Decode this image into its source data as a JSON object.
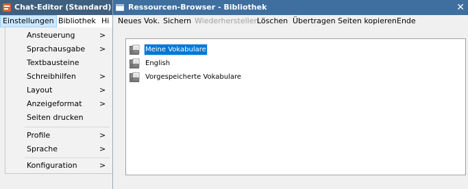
{
  "left_window": {
    "title": "Chat-Editor (Standard)",
    "menubar": [
      {
        "label": "Einstellungen"
      },
      {
        "label": "Bibliothek"
      },
      {
        "label": "Hi"
      }
    ],
    "dropdown": {
      "items": [
        {
          "label": "Ansteuerung",
          "submenu": true
        },
        {
          "label": "Sprachausgabe",
          "submenu": true
        },
        {
          "label": "Textbausteine",
          "submenu": false
        },
        {
          "label": "Schreibhilfen",
          "submenu": true
        },
        {
          "label": "Layout",
          "submenu": true
        },
        {
          "label": "Anzeigeformat",
          "submenu": true
        },
        {
          "label": "Seiten drucken",
          "submenu": false
        },
        {
          "label": "Profile",
          "submenu": true
        },
        {
          "label": "Sprache",
          "submenu": true
        },
        {
          "label": "Konfiguration",
          "submenu": true
        }
      ],
      "arrow": ">"
    }
  },
  "right_window": {
    "title": "Ressourcen-Browser - Bibliothek",
    "close_glyph": "✕",
    "menubar": [
      {
        "label": "Neues Vok.",
        "enabled": true
      },
      {
        "label": "Sichern",
        "enabled": true
      },
      {
        "label": "Wiederherstellen",
        "enabled": false
      },
      {
        "label": "Löschen",
        "enabled": true
      },
      {
        "label": "Übertragen",
        "enabled": true
      },
      {
        "label": "Seiten kopieren",
        "enabled": true
      },
      {
        "label": "Ende",
        "enabled": true
      }
    ],
    "list": [
      {
        "label": "Meine Vokabulare",
        "selected": true,
        "icon": "folder-document-icon"
      },
      {
        "label": "English",
        "selected": false,
        "icon": "folder-document-icon"
      },
      {
        "label": "Vorgespeicherte Vokabulare",
        "selected": false,
        "icon": "folder-document-icon"
      }
    ]
  },
  "colors": {
    "left_caption": "#3f5f7f",
    "right_caption": "#3f6f9f",
    "selection": "#0078d7",
    "menu_highlight": "#cce8ff"
  }
}
